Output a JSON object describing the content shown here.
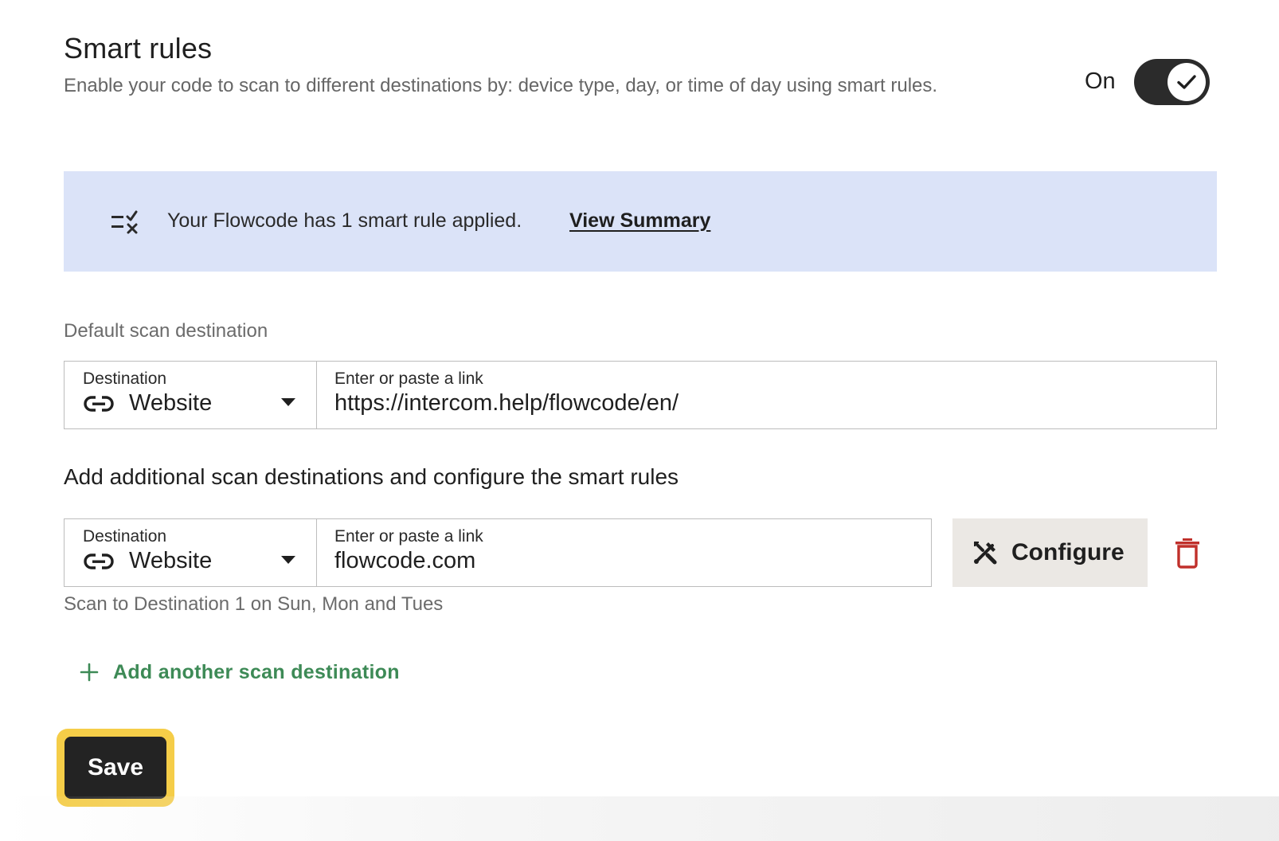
{
  "smart_rules": {
    "title": "Smart rules",
    "description": "Enable your code to scan to different destinations by: device type, day, or time of day using smart rules.",
    "toggle_label": "On",
    "toggle_state": "on"
  },
  "banner": {
    "icon": "rules-check-icon",
    "text": "Your Flowcode has 1 smart rule applied.",
    "link_label": "View Summary",
    "background": "#dbe3f8"
  },
  "default_destination": {
    "section_label": "Default scan destination",
    "select_caption": "Destination",
    "select_icon": "link-icon",
    "select_value": "Website",
    "link_caption": "Enter or paste a link",
    "link_value": "https://intercom.help/flowcode/en/"
  },
  "additional": {
    "heading": "Add additional scan destinations and configure the smart rules",
    "destinations": [
      {
        "select_caption": "Destination",
        "select_icon": "link-icon",
        "select_value": "Website",
        "link_caption": "Enter or paste a link",
        "link_value": "flowcode.com",
        "configure_label": "Configure",
        "configure_icon": "tools-icon",
        "delete_icon": "trash-icon",
        "rule_summary": "Scan to Destination 1 on Sun, Mon and Tues"
      }
    ],
    "add_label": "Add another scan destination",
    "add_color": "#3d8a56"
  },
  "save": {
    "label": "Save",
    "focus_ring_color": "#f5cd48",
    "delete_color": "#c0302b"
  }
}
